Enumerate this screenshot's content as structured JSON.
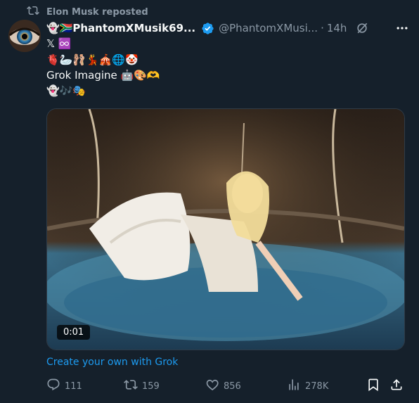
{
  "repost": {
    "text": "Elon Musk reposted"
  },
  "author": {
    "display_name": "👻🇿🇦PhantomXMusik69...",
    "handle": "@PhantomXMusi...",
    "separator": "·",
    "time": "14h"
  },
  "tweet": {
    "lines": [
      "𝕏 ♾️",
      "🫀🦢🩰💃🎪🌐🤡",
      "Grok Imagine 🤖🎨🫶",
      "👻🎶🎭"
    ]
  },
  "media": {
    "duration": "0:01"
  },
  "grok_link": "Create your own with Grok",
  "actions": {
    "replies": "111",
    "reposts": "159",
    "likes": "856",
    "views": "278K"
  },
  "colors": {
    "background": "#15202b",
    "text": "#f7f9f9",
    "muted": "#8b98a5",
    "link": "#1d9bf0",
    "verified": "#1d9bf0"
  },
  "icons": [
    "repost-icon",
    "verified-badge-icon",
    "grok-icon",
    "more-icon",
    "reply-icon",
    "like-icon",
    "views-icon",
    "bookmark-icon",
    "share-icon"
  ]
}
